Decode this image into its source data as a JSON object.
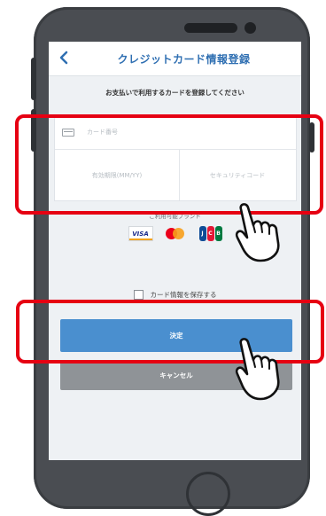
{
  "screen": {
    "nav": {
      "back_icon": "chevron-left-icon",
      "title": "クレジットカード情報登録"
    },
    "instruction": "お支払いで利用するカードを登録してください",
    "card_form": {
      "card_number_placeholder": "カード番号",
      "expiry_placeholder": "有効期限(MM/YY)",
      "security_code_placeholder": "セキュリティコード"
    },
    "brands": {
      "label": "ご利用可能ブランド",
      "items": [
        "VISA",
        "mastercard-logo",
        "JCB"
      ]
    },
    "save_card_label": "カード情報を保存する",
    "save_card_checked": false,
    "submit_label": "決定",
    "cancel_label": "キャンセル"
  },
  "colors": {
    "accent": "#2f6fb2",
    "submit_button": "#4a8fcf",
    "cancel_button": "#8f9397",
    "highlight": "#e60012",
    "phone_body": "#4a4d52",
    "screen_bg": "#eef1f4"
  }
}
